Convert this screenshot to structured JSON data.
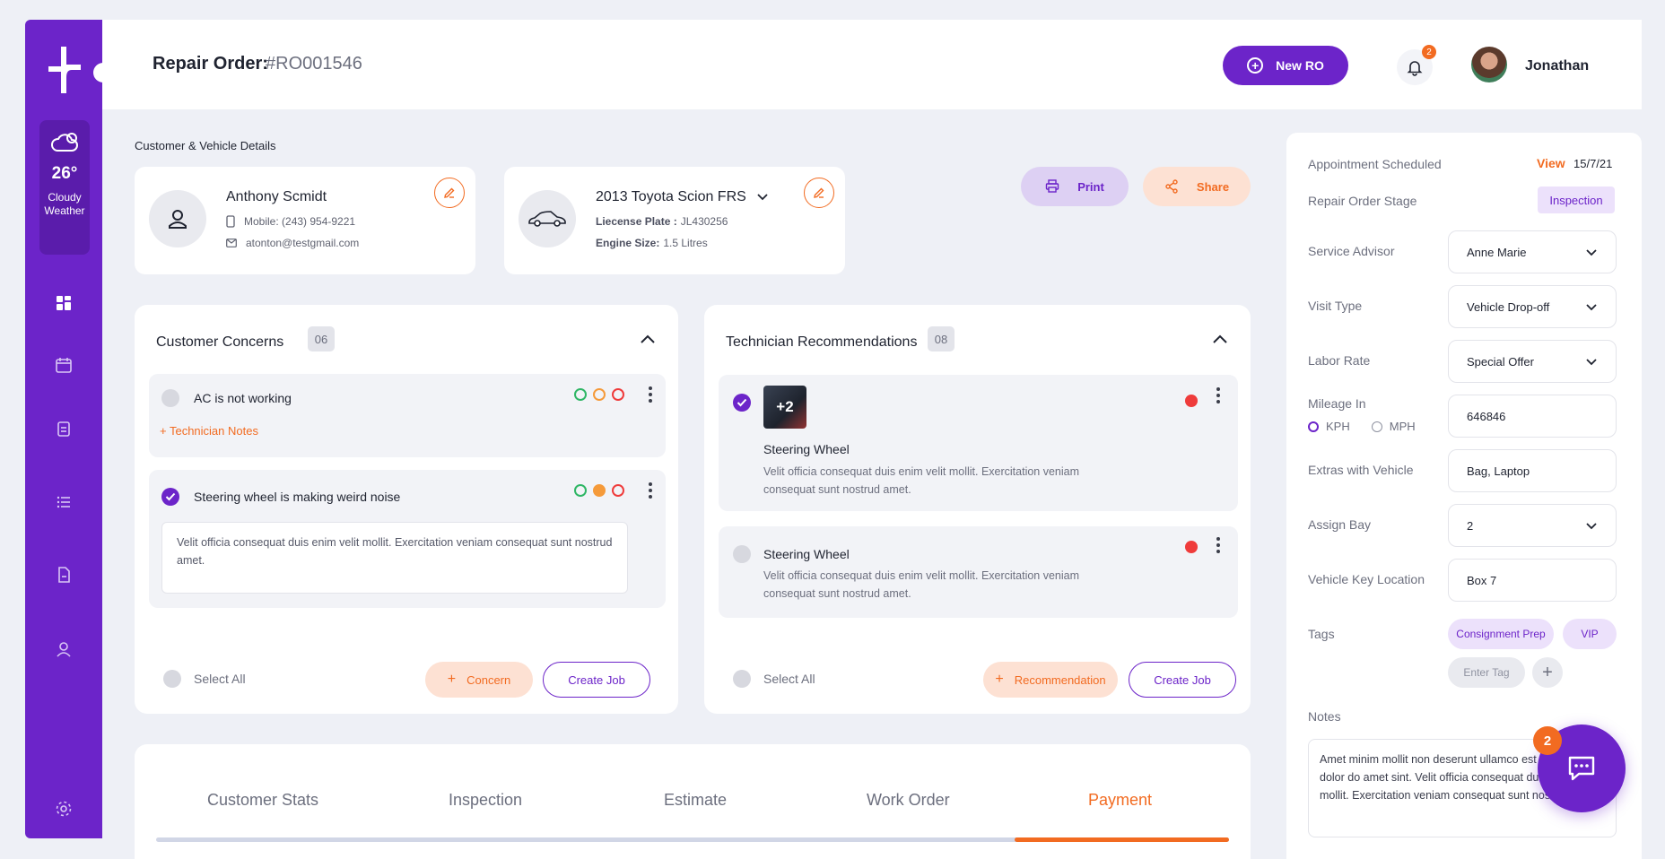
{
  "brand": {
    "accent": "#6c24c9",
    "orange": "#f26b21"
  },
  "weather": {
    "temp": "26°",
    "condition_line1": "Cloudy",
    "condition_line2": "Weather"
  },
  "header": {
    "title": "Repair Order:",
    "ro_number": "#RO001546",
    "new_ro_label": "New RO",
    "notification_count": "2",
    "user_name": "Jonathan"
  },
  "customer_vehicle": {
    "section_title": "Customer & Vehicle Details",
    "customer": {
      "name": "Anthony Scmidt",
      "mobile": "Mobile: (243) 954-9221",
      "email": "atonton@testgmail.com"
    },
    "vehicle": {
      "name": "2013 Toyota Scion FRS",
      "plate_label": "Liecense Plate :",
      "plate_value": "JL430256",
      "engine_label": "Engine Size:",
      "engine_value": "1.5 Litres"
    },
    "print_label": "Print",
    "share_label": "Share"
  },
  "concerns": {
    "title": "Customer Concerns",
    "count": "06",
    "items": [
      {
        "title": "AC is not working",
        "note_link": "Technician Notes"
      },
      {
        "title": "Steering wheel is making weird noise",
        "note": "Velit officia consequat duis enim velit mollit. Exercitation veniam consequat sunt nostrud amet."
      }
    ],
    "select_all": "Select All",
    "add_label": "Concern",
    "create_job": "Create Job"
  },
  "recommendations": {
    "title": "Technician Recommendations",
    "count": "08",
    "items": [
      {
        "thumb_label": "+2",
        "title": "Steering Wheel",
        "desc": "Velit officia consequat duis enim velit mollit. Exercitation veniam consequat sunt nostrud amet."
      },
      {
        "title": "Steering Wheel",
        "desc": "Velit officia consequat duis enim velit mollit. Exercitation veniam consequat sunt nostrud amet."
      }
    ],
    "select_all": "Select All",
    "add_label": "Recommendation",
    "create_job": "Create Job"
  },
  "details": {
    "appointment_label": "Appointment Scheduled",
    "appointment_view": "View",
    "appointment_date": "15/7/21",
    "stage_label": "Repair Order Stage",
    "stage_value": "Inspection",
    "advisor_label": "Service Advisor",
    "advisor_value": "Anne Marie",
    "visit_label": "Visit Type",
    "visit_value": "Vehicle Drop-off",
    "labor_label": "Labor Rate",
    "labor_value": "Special Offer",
    "mileage_label": "Mileage In",
    "mileage_value": "646846",
    "unit_kph": "KPH",
    "unit_mph": "MPH",
    "extras_label": "Extras with Vehicle",
    "extras_value": "Bag, Laptop",
    "bay_label": "Assign Bay",
    "bay_value": "2",
    "key_label": "Vehicle Key Location",
    "key_value": "Box 7",
    "tags_label": "Tags",
    "tags": [
      "Consignment Prep",
      "VIP"
    ],
    "tag_placeholder": "Enter Tag",
    "notes_label": "Notes",
    "notes_value": "Amet minim mollit non deserunt ullamco est sit aliqua dolor do amet sint. Velit officia consequat duis enim velit mollit. Exercitation veniam consequat sunt nostrud amet."
  },
  "chat": {
    "badge": "2"
  },
  "workflow_tabs": {
    "tabs": [
      "Customer Stats",
      "Inspection",
      "Estimate",
      "Work Order",
      "Payment"
    ],
    "active": "Payment",
    "progress_fraction": 0.2
  }
}
